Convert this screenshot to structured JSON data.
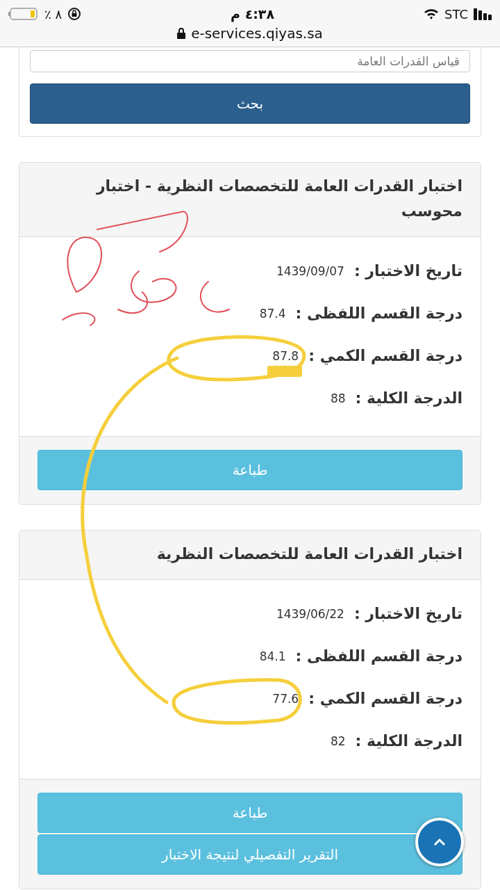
{
  "status_bar": {
    "battery_text": "٪ ٨",
    "time": "٤:٣٨ م",
    "carrier": "STC"
  },
  "address_bar": {
    "url": "e-services.qiyas.sa"
  },
  "search_panel": {
    "select_value": "قياس القدرات العامة",
    "button": "بحث"
  },
  "results": [
    {
      "title": "اختبار القدرات العامة للتخصصات النظرية - اختبار محوسب",
      "rows": [
        {
          "label": "تاريخ الاختبار :",
          "value": "1439/09/07"
        },
        {
          "label": "درجة القسم اللفظى :",
          "value": "87.4"
        },
        {
          "label": "درجة القسم الكمي :",
          "value": "87.8"
        },
        {
          "label": "الدرجة الكلية :",
          "value": "88"
        }
      ],
      "buttons": [
        "طباعة"
      ]
    },
    {
      "title": "اختبار القدرات العامة للتخصصات النظرية",
      "rows": [
        {
          "label": "تاريخ الاختبار :",
          "value": "1439/06/22"
        },
        {
          "label": "درجة القسم اللفظى :",
          "value": "84.1"
        },
        {
          "label": "درجة القسم الكمي :",
          "value": "77.6"
        },
        {
          "label": "الدرجة الكلية :",
          "value": "82"
        }
      ],
      "buttons": [
        "طباعة",
        "التقرير التفصيلي لنتيجة الاختبار"
      ]
    }
  ],
  "annotations": [
    {
      "kind": "highlight-loop",
      "color": "#f5cf3c"
    },
    {
      "kind": "scribble",
      "color": "#e0505a"
    }
  ]
}
